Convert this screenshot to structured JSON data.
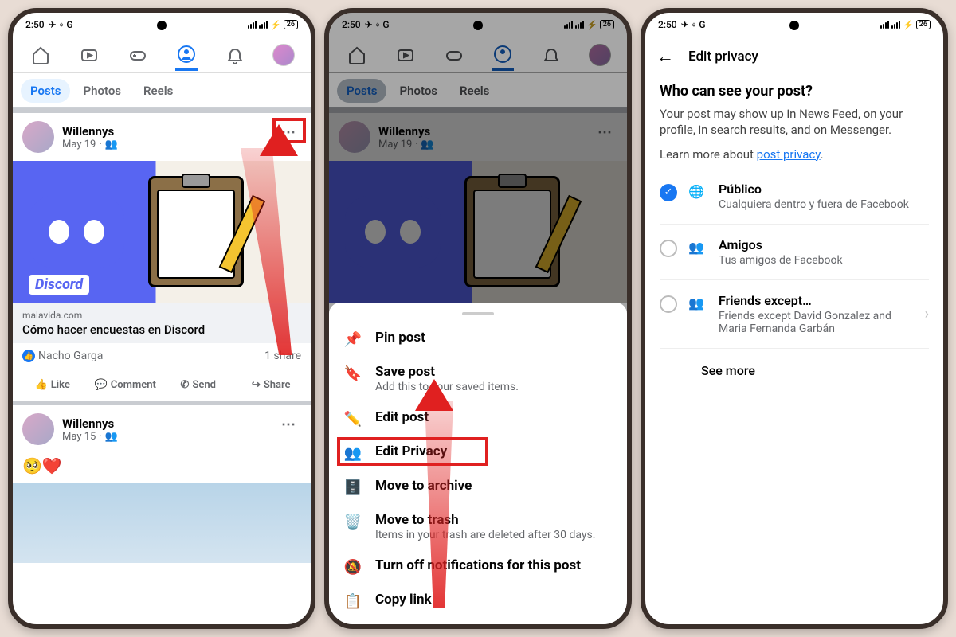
{
  "status": {
    "time": "2:50",
    "battery": "26"
  },
  "tabs": {
    "posts": "Posts",
    "photos": "Photos",
    "reels": "Reels"
  },
  "post1": {
    "user": "Willennys",
    "date": "May 19",
    "discord_label": "Discord",
    "link_domain": "malavida.com",
    "link_title": "Cómo hacer encuestas en Discord",
    "reactor": "Nacho Garga",
    "shares": "1 share"
  },
  "actions": {
    "like": "Like",
    "comment": "Comment",
    "send": "Send",
    "share": "Share"
  },
  "post2": {
    "user": "Willennys",
    "date": "May 15",
    "emoji": "🥺❤️"
  },
  "sheet": {
    "pin": "Pin post",
    "save": "Save post",
    "save_sub": "Add this to your saved items.",
    "edit": "Edit post",
    "privacy": "Edit Privacy",
    "archive": "Move to archive",
    "trash": "Move to trash",
    "trash_sub": "Items in your trash are deleted after 30 days.",
    "notif": "Turn off notifications for this post",
    "copy": "Copy link"
  },
  "privacy": {
    "header": "Edit privacy",
    "question": "Who can see your post?",
    "desc": "Your post may show up in News Feed, on your profile, in search results, and on Messenger.",
    "learn_prefix": "Learn more about ",
    "learn_link": "post privacy",
    "opt1_title": "Público",
    "opt1_sub": "Cualquiera dentro y fuera de Facebook",
    "opt2_title": "Amigos",
    "opt2_sub": "Tus amigos de Facebook",
    "opt3_title": "Friends except…",
    "opt3_sub": "Friends except David Gonzalez and Maria Fernanda Garbán",
    "see_more": "See more"
  }
}
